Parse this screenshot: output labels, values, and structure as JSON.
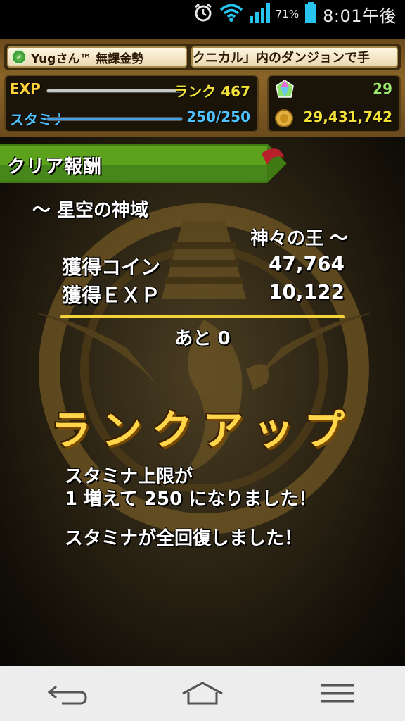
{
  "status_bar": {
    "battery_percent": "71%",
    "time": "8:01午後",
    "icons": [
      "alarm-icon",
      "wifi-icon",
      "signal-icon",
      "battery-icon"
    ]
  },
  "hud": {
    "player_name": "Yugさん™ 無課金勢",
    "ticker": "クニカル」内のダンジョンで手",
    "exp_label": "EXP",
    "rank_label": "ランク 467",
    "stamina_label": "スタミナ",
    "stamina_value": "250/250",
    "stones": "29",
    "coins": "29,431,742",
    "exp_progress": 0.98,
    "stamina_progress": 1.0,
    "colors": {
      "exp_label": "#ffd23a",
      "stamina_label": "#4fc3ff",
      "value_yellow": "#f2e23a",
      "stamina_fill": "#3fa0e8"
    }
  },
  "result": {
    "ribbon_title": "クリア報酬",
    "dungeon_line1": "～ 星空の神域",
    "dungeon_line2": "神々の王 ～",
    "coin_label": "獲得コイン",
    "coin_value": "47,764",
    "exp_label": "獲得ＥＸＰ",
    "exp_value": "10,122",
    "remaining": "あと 0",
    "rankup": "ランクアップ",
    "msg1_line1": "スタミナ上限が",
    "msg1_line2": "1 増えて 250 になりました！",
    "msg2": "スタミナが全回復しました！"
  },
  "navbar": {
    "icons": [
      "back-icon",
      "home-icon",
      "menu-icon"
    ]
  }
}
